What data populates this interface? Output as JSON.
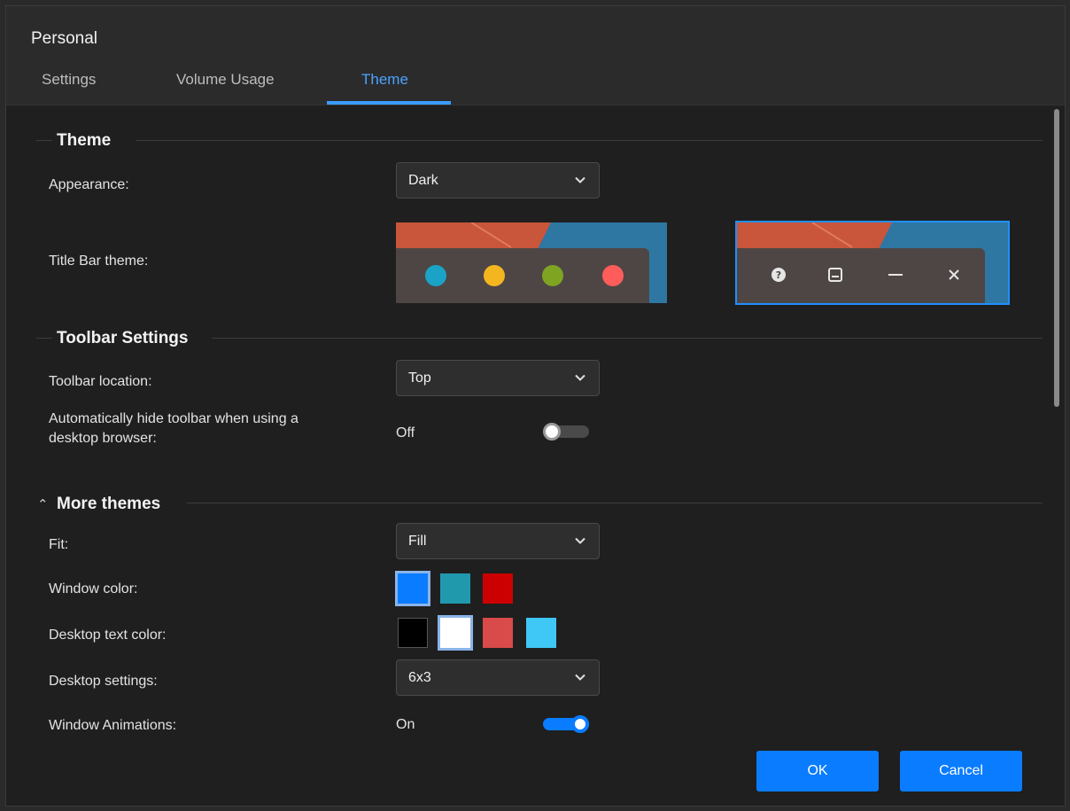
{
  "dialog": {
    "title": "Personal",
    "tabs": [
      {
        "label": "Settings",
        "active": false
      },
      {
        "label": "Volume Usage",
        "active": false
      },
      {
        "label": "Theme",
        "active": true
      }
    ]
  },
  "theme_section": {
    "heading": "Theme",
    "appearance": {
      "label": "Appearance:",
      "value": "Dark"
    },
    "title_bar": {
      "label": "Title Bar theme:",
      "options": [
        {
          "style": "mac",
          "dot_colors": [
            "#1aa3c6",
            "#f3b61f",
            "#7ea421",
            "#ff5c5c"
          ],
          "selected": false
        },
        {
          "style": "windows",
          "icons": [
            "help-icon",
            "minimize-window-icon",
            "minimize-icon",
            "close-icon"
          ],
          "selected": true
        }
      ]
    }
  },
  "toolbar_section": {
    "heading": "Toolbar Settings",
    "location": {
      "label": "Toolbar location:",
      "value": "Top"
    },
    "auto_hide": {
      "label_line1": "Automatically hide toolbar when using a",
      "label_line2": "desktop browser:",
      "state_text": "Off",
      "on": false
    }
  },
  "more_themes": {
    "heading": "More themes",
    "fit": {
      "label": "Fit:",
      "value": "Fill"
    },
    "window_color": {
      "label": "Window color:",
      "swatches": [
        "#0a7cff",
        "#2199ad",
        "#cc0000"
      ],
      "selected_index": 0
    },
    "desktop_text_color": {
      "label": "Desktop text color:",
      "swatches": [
        "#000000",
        "#ffffff",
        "#d94a4a",
        "#3fc8f5"
      ],
      "selected_index": 1
    },
    "desktop_settings": {
      "label": "Desktop settings:",
      "value": "6x3"
    },
    "window_animations": {
      "label": "Window Animations:",
      "state_text": "On",
      "on": true
    }
  },
  "buttons": {
    "ok": "OK",
    "cancel": "Cancel"
  },
  "colors": {
    "accent": "#0a7cff",
    "background": "#1f1f1f"
  }
}
